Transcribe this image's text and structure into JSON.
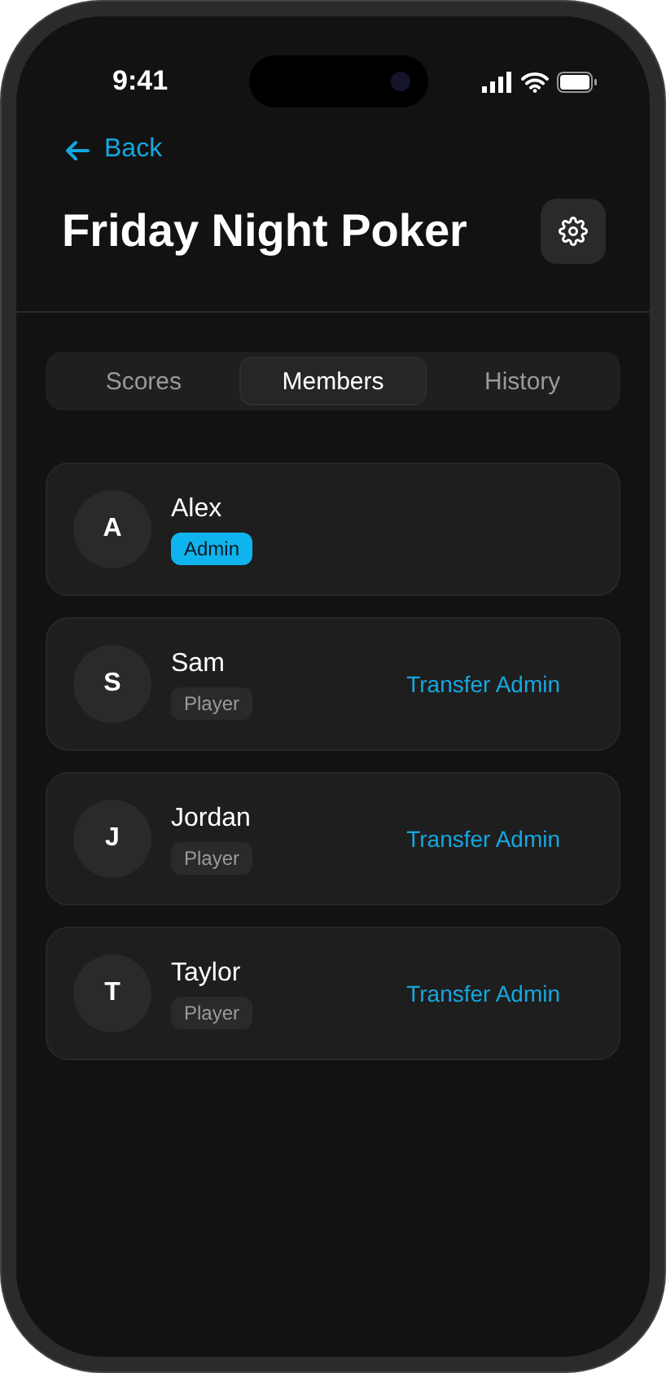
{
  "status_bar": {
    "time": "9:41"
  },
  "header": {
    "back": "Back",
    "title": "Friday Night Poker"
  },
  "tabs": [
    {
      "label": "Scores",
      "selected": false
    },
    {
      "label": "Members",
      "selected": true
    },
    {
      "label": "History",
      "selected": false
    }
  ],
  "members": [
    {
      "initial": "A",
      "name": "Alex",
      "kind": "admin",
      "role": "Admin"
    },
    {
      "initial": "S",
      "name": "Sam",
      "kind": "player",
      "role": "Player",
      "action": "Transfer Admin"
    },
    {
      "initial": "J",
      "name": "Jordan",
      "kind": "player",
      "role": "Player",
      "action": "Transfer Admin"
    },
    {
      "initial": "T",
      "name": "Taylor",
      "kind": "player",
      "role": "Player",
      "action": "Transfer Admin"
    }
  ]
}
